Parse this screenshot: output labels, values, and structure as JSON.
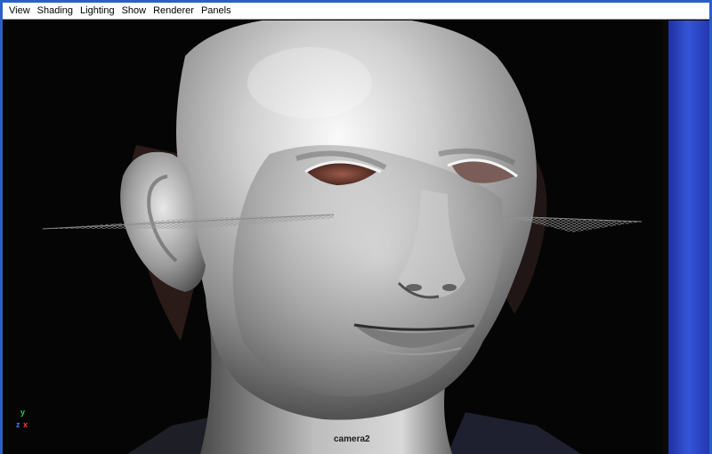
{
  "menubar": {
    "items": [
      "View",
      "Shading",
      "Lighting",
      "Show",
      "Renderer",
      "Panels"
    ]
  },
  "viewport": {
    "camera_label": "camera2",
    "axis": {
      "y": "y",
      "z": "z",
      "x": "x"
    }
  },
  "colors": {
    "frame_blue": "#2a5fc7",
    "menu_bg": "#ffffff",
    "viewport_bg": "#000000",
    "panel_blue": "#2c3fbf"
  }
}
